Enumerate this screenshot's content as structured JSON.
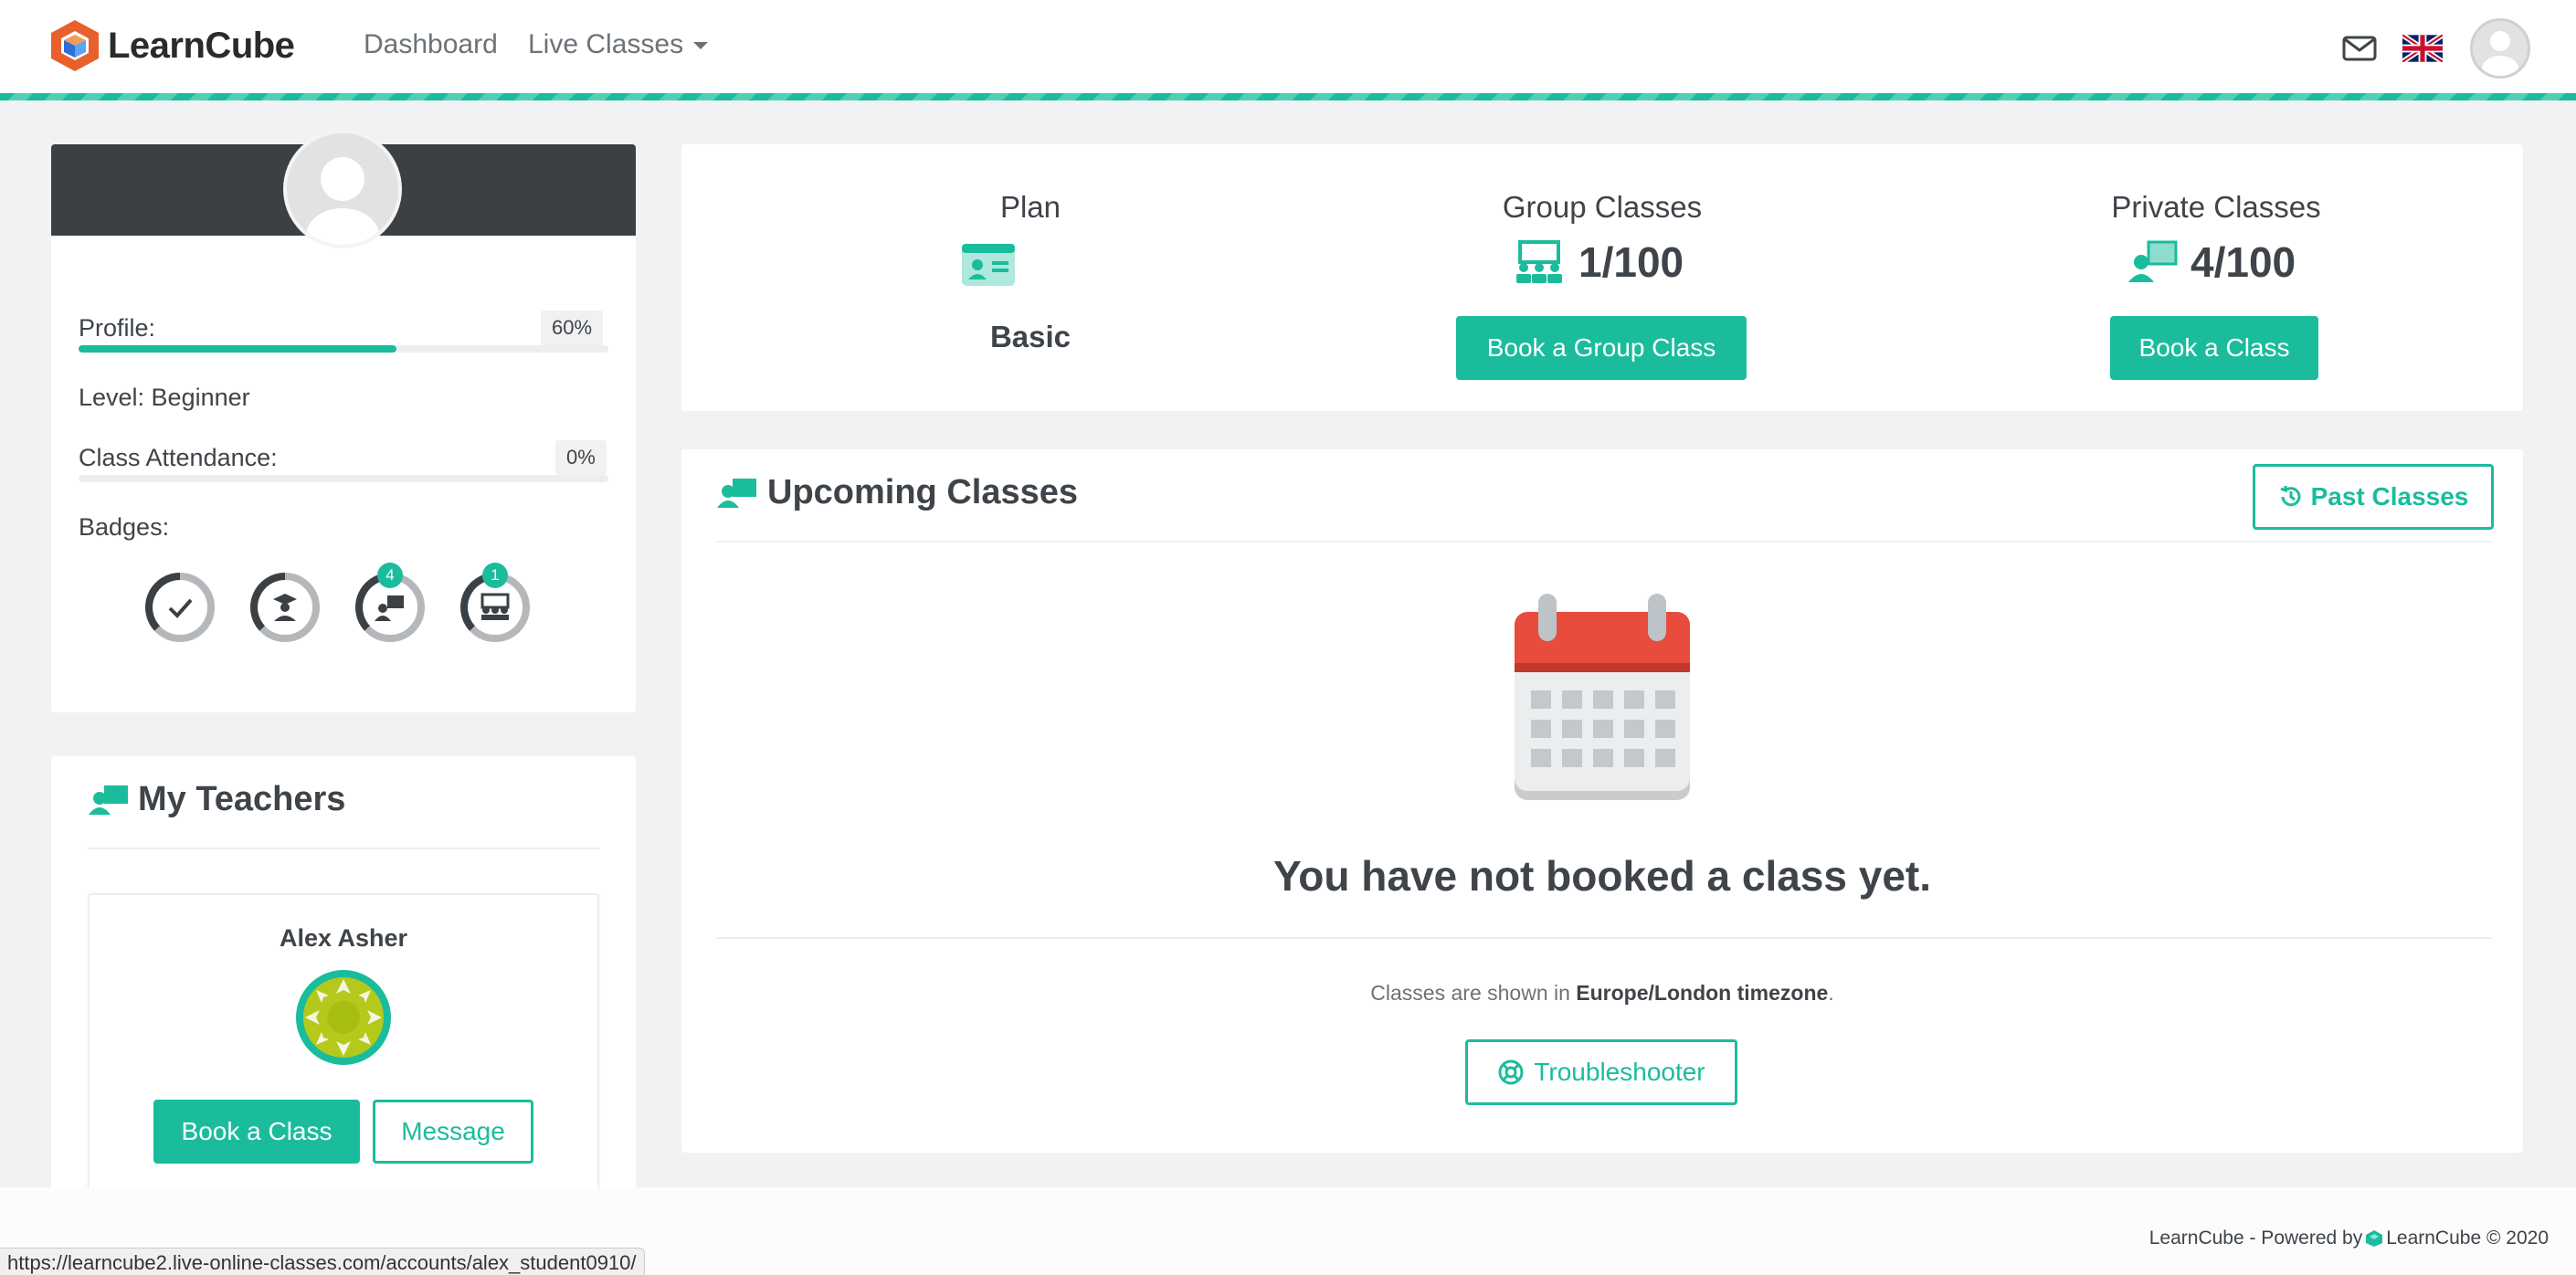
{
  "navbar": {
    "brand": "LearnCube",
    "links": {
      "dashboard": "Dashboard",
      "live_classes": "Live Classes"
    },
    "icons": [
      "envelope-icon",
      "uk-flag-icon",
      "user-avatar"
    ]
  },
  "profile": {
    "profile_label": "Profile:",
    "profile_pct_text": "60%",
    "profile_pct": 0.6,
    "level": "Level: Beginner",
    "attendance_label": "Class Attendance:",
    "attendance_pct_text": "0%",
    "attendance_pct": 0,
    "badges_label": "Badges:",
    "badges": [
      {
        "icon": "check-icon",
        "count": ""
      },
      {
        "icon": "graduate-icon",
        "count": ""
      },
      {
        "icon": "private-class-icon",
        "count": "4"
      },
      {
        "icon": "group-class-icon",
        "count": "1"
      }
    ]
  },
  "teachers": {
    "title": "My Teachers",
    "items": [
      {
        "name": "Alex Asher",
        "book_label": "Book a Class",
        "message_label": "Message"
      }
    ]
  },
  "stats": {
    "plan": {
      "title": "Plan",
      "value": "Basic"
    },
    "group": {
      "title": "Group Classes",
      "count": "1/100",
      "button": "Book a Group Class"
    },
    "private": {
      "title": "Private Classes",
      "count": "4/100",
      "button": "Book a Class"
    }
  },
  "upcoming": {
    "title": "Upcoming Classes",
    "past_button": "Past Classes",
    "empty_message": "You have not booked a class yet.",
    "tz_prefix": "Classes are shown in ",
    "tz_value": "Europe/London timezone",
    "tz_suffix": ".",
    "troubleshooter": "Troubleshooter"
  },
  "footer": {
    "prefix": "LearnCube - Powered by ",
    "brand": "LearnCube",
    "suffix": " © 2020"
  },
  "status_url": "https://learncube2.live-online-classes.com/accounts/alex_student0910/",
  "colors": {
    "accent": "#1abc9c",
    "dark_header": "#3b4045",
    "calendar_red": "#e74c3c"
  }
}
